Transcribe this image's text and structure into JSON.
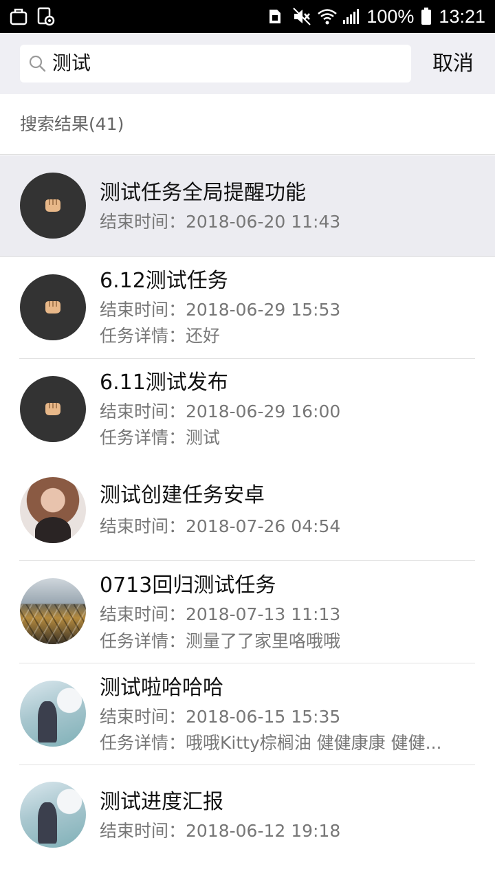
{
  "status_bar": {
    "battery_percent": "100%",
    "time": "13:21",
    "icons": [
      "bag-icon",
      "screen-record-icon",
      "sim-icon",
      "mute-icon",
      "wifi-icon",
      "signal-icon",
      "battery-icon"
    ]
  },
  "search": {
    "query": "测试",
    "cancel_label": "取消"
  },
  "results_header": "搜索结果(41)",
  "results": [
    {
      "title": "测试任务全局提醒功能",
      "end_time": "结束时间：2018-06-20 11:43",
      "detail": null,
      "avatar": "fist-avatar",
      "highlighted": true
    },
    {
      "title": "6.12测试任务",
      "end_time": "结束时间：2018-06-29 15:53",
      "detail": "任务详情：还好",
      "avatar": "fist-avatar"
    },
    {
      "title": "6.11测试发布",
      "end_time": "结束时间：2018-06-29 16:00",
      "detail": "任务详情：测试",
      "avatar": "fist-avatar"
    },
    {
      "title": "测试创建任务安卓",
      "end_time": "结束时间：2018-07-26 04:54",
      "detail": null,
      "avatar": "girl-photo-avatar"
    },
    {
      "title": "0713回归测试任务",
      "end_time": "结束时间：2018-07-13 11:13",
      "detail": "任务详情：测量了了家里咯哦哦",
      "avatar": "tiles-photo-avatar"
    },
    {
      "title": "测试啦哈哈哈",
      "end_time": "结束时间：2018-06-15 15:35",
      "detail": "任务详情：哦哦Kitty棕榈油 健健康康 健健...",
      "avatar": "pastel-photo-avatar"
    },
    {
      "title": "测试进度汇报",
      "end_time": "结束时间：2018-06-12 19:18",
      "detail": null,
      "avatar": "pastel-photo-avatar"
    }
  ],
  "colors": {
    "status_bar_bg": "#000000",
    "header_bg": "#efeff4",
    "highlight_bg": "#ececf1",
    "secondary_text": "#777777"
  }
}
